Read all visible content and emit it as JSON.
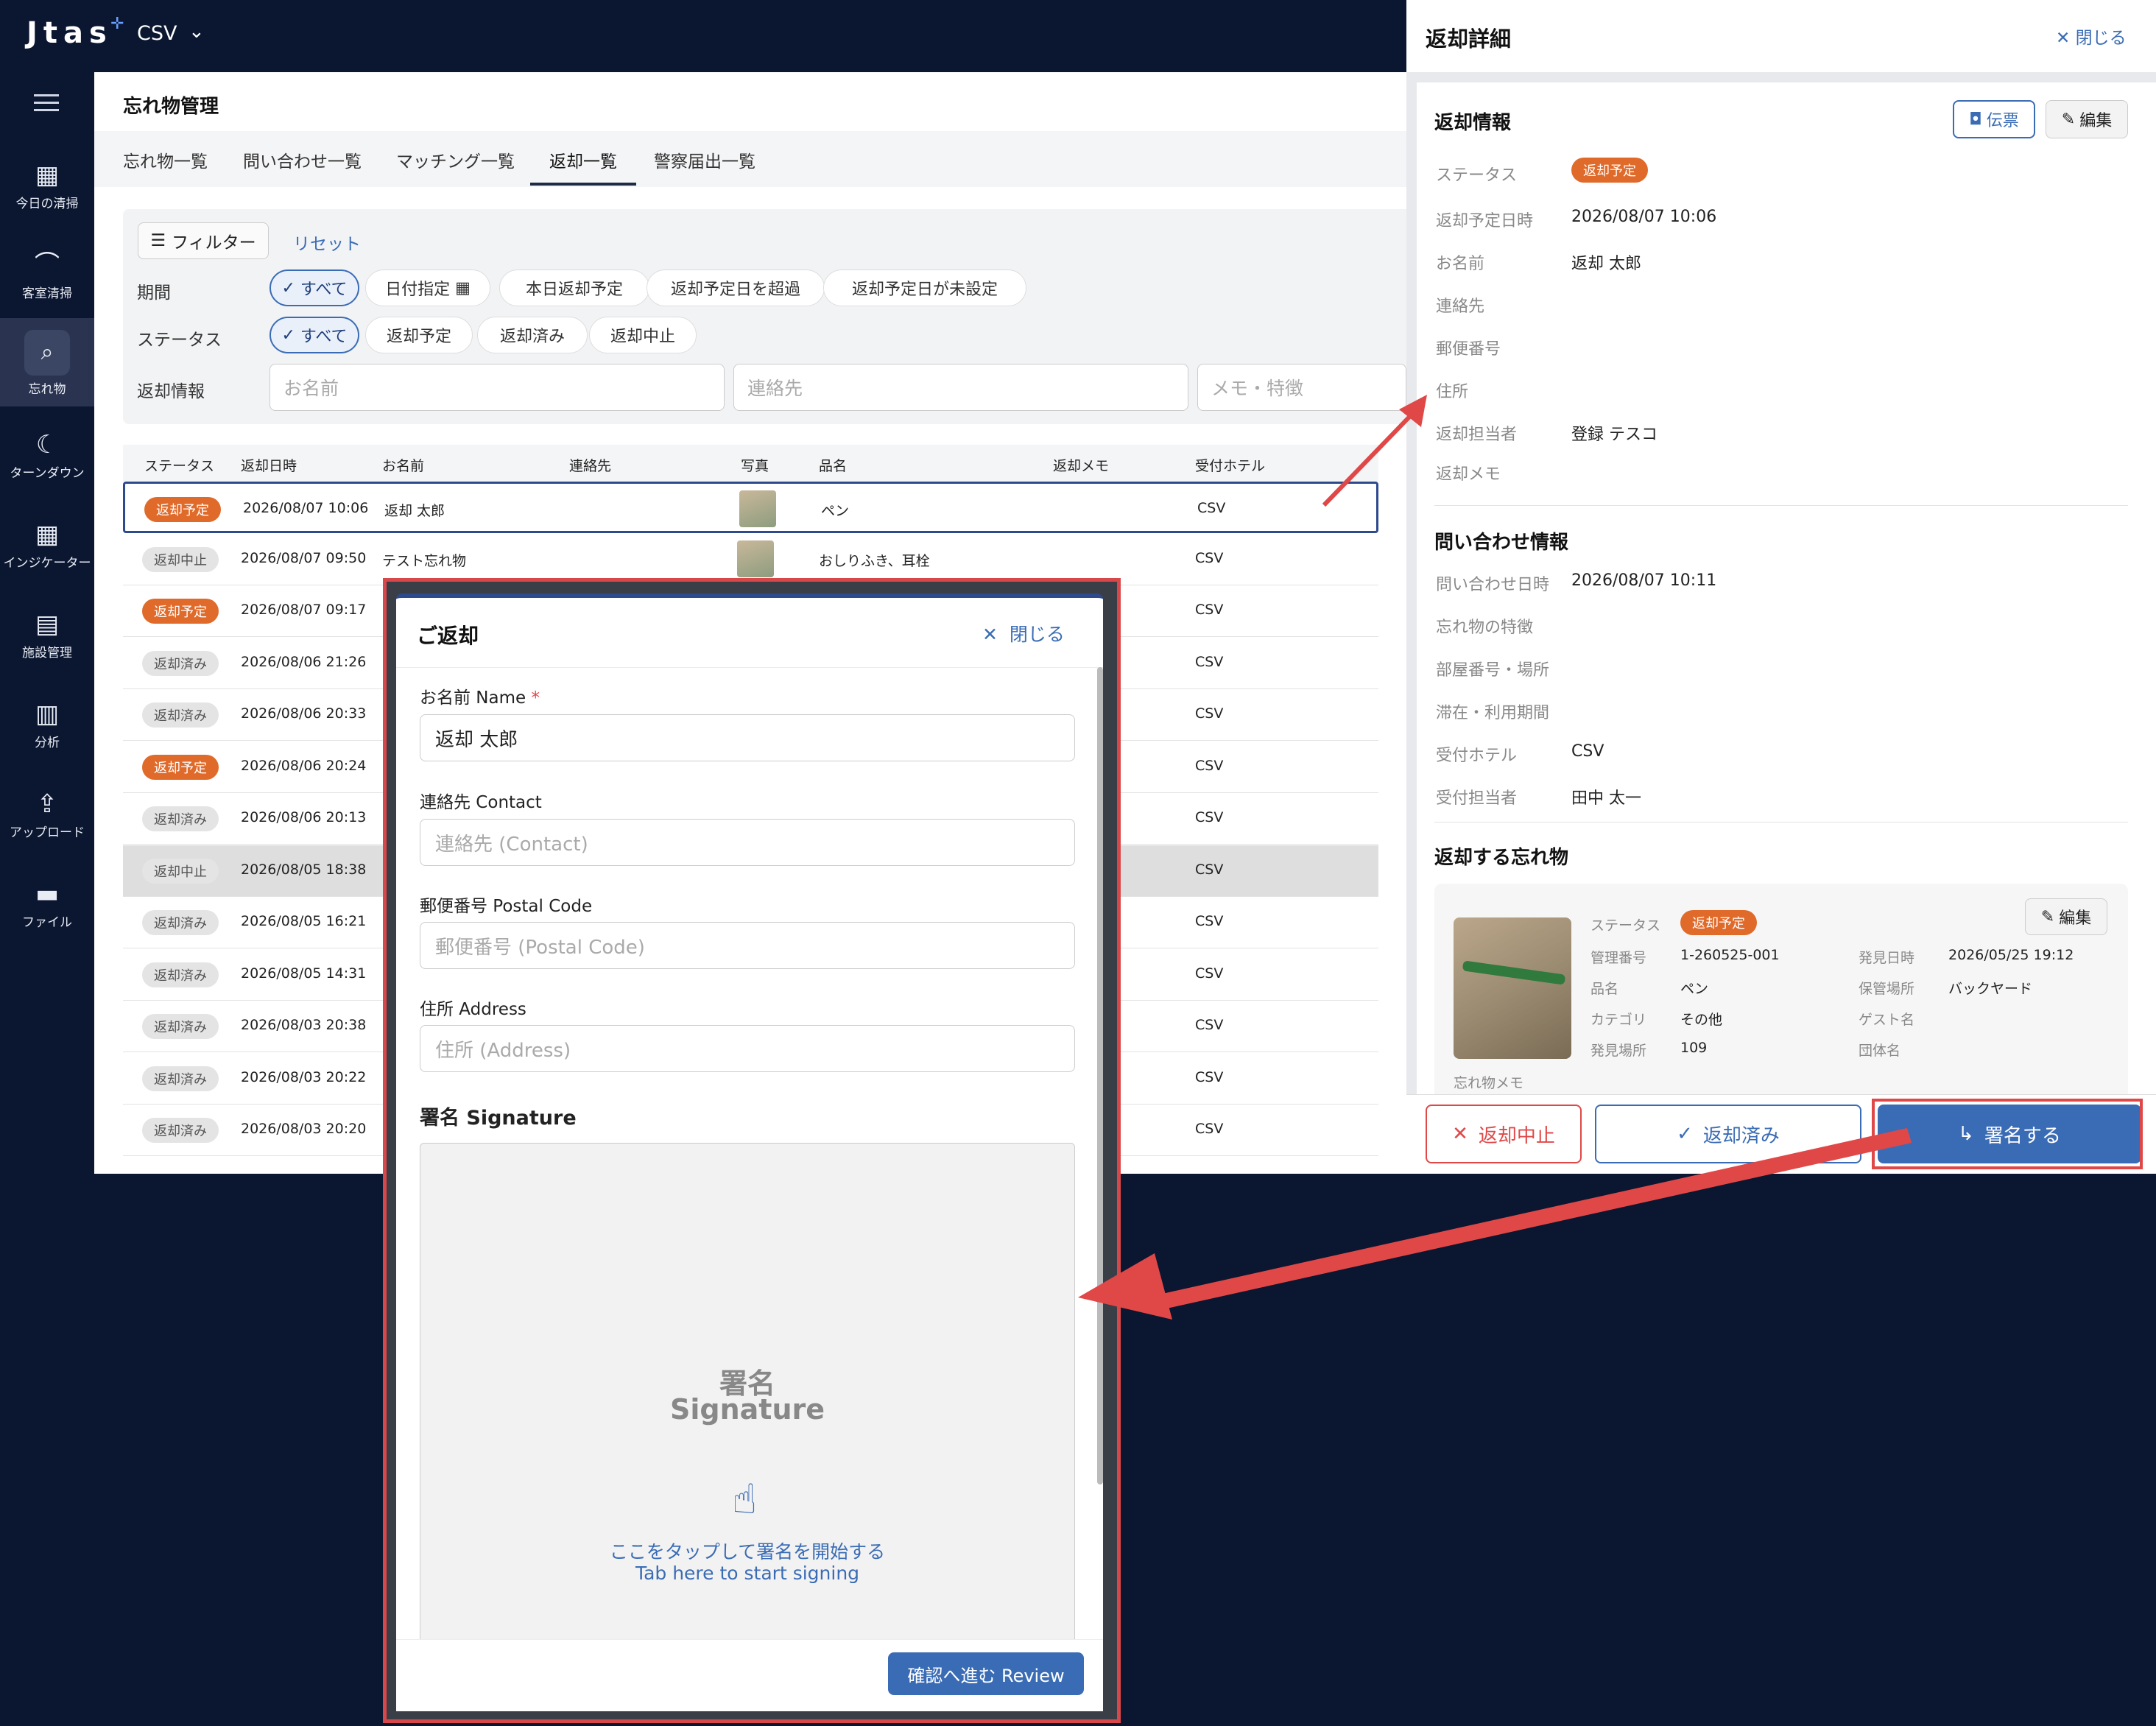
{
  "app": {
    "logo": "Jtas",
    "hotel": "CSV"
  },
  "sidebar": {
    "items": [
      {
        "label": "今日の清掃",
        "icon": "calendar-icon",
        "glyph": "▦"
      },
      {
        "label": "客室清掃",
        "icon": "broom-icon",
        "glyph": "⌒"
      },
      {
        "label": "忘れ物",
        "icon": "search-icon",
        "glyph": "⌕",
        "active": true
      },
      {
        "label": "ターンダウン",
        "icon": "moon-icon",
        "glyph": "☾"
      },
      {
        "label": "インジケーター",
        "icon": "grid-icon",
        "glyph": "▦"
      },
      {
        "label": "施設管理",
        "icon": "clipboard-icon",
        "glyph": "▤"
      },
      {
        "label": "分析",
        "icon": "chart-icon",
        "glyph": "▥"
      },
      {
        "label": "アップロード",
        "icon": "upload-icon",
        "glyph": "⇪"
      },
      {
        "label": "ファイル",
        "icon": "folder-icon",
        "glyph": "▬"
      }
    ]
  },
  "page": {
    "title": "忘れ物管理"
  },
  "tabs": [
    "忘れ物一覧",
    "問い合わせ一覧",
    "マッチング一覧",
    "返却一覧",
    "警察届出一覧"
  ],
  "filter": {
    "button": "フィルター",
    "reset": "リセット",
    "period_label": "期間",
    "period_chips": [
      "すべて",
      "日付指定",
      "本日返却予定",
      "返却予定日を超過",
      "返却予定日が未設定"
    ],
    "status_label": "ステータス",
    "status_chips": [
      "すべて",
      "返却予定",
      "返却済み",
      "返却中止"
    ],
    "info_label": "返却情報",
    "name_placeholder": "お名前",
    "contact_placeholder": "連絡先",
    "memo_placeholder": "メモ・特徴"
  },
  "table": {
    "headers": [
      "ステータス",
      "返却日時",
      "お名前",
      "連絡先",
      "写真",
      "品名",
      "返却メモ",
      "受付ホテル"
    ],
    "rows": [
      {
        "status": "返却予定",
        "datetime": "2026/08/07 10:06",
        "name": "返却 太郎",
        "item": "ペン",
        "hotel": "CSV",
        "photo": true
      },
      {
        "status": "返却中止",
        "datetime": "2026/08/07 09:50",
        "name": "テスト忘れ物",
        "item": "おしりふき、耳栓",
        "hotel": "CSV",
        "photo": true
      },
      {
        "status": "返却予定",
        "datetime": "2026/08/07 09:17",
        "name": "",
        "item": "",
        "hotel": "CSV"
      },
      {
        "status": "返却済み",
        "datetime": "2026/08/06 21:26",
        "name": "",
        "item": "",
        "hotel": "CSV"
      },
      {
        "status": "返却済み",
        "datetime": "2026/08/06 20:33",
        "name": "",
        "item": "",
        "hotel": "CSV"
      },
      {
        "status": "返却予定",
        "datetime": "2026/08/06 20:24",
        "name": "",
        "item": "",
        "hotel": "CSV"
      },
      {
        "status": "返却済み",
        "datetime": "2026/08/06 20:13",
        "name": "",
        "item": "",
        "hotel": "CSV"
      },
      {
        "status": "返却中止",
        "datetime": "2026/08/05 18:38",
        "name": "",
        "item": "",
        "hotel": "CSV"
      },
      {
        "status": "返却済み",
        "datetime": "2026/08/05 16:21",
        "name": "",
        "item": "",
        "hotel": "CSV"
      },
      {
        "status": "返却済み",
        "datetime": "2026/08/05 14:31",
        "name": "",
        "item": "",
        "hotel": "CSV"
      },
      {
        "status": "返却済み",
        "datetime": "2026/08/03 20:38",
        "name": "",
        "item": "",
        "hotel": "CSV"
      },
      {
        "status": "返却済み",
        "datetime": "2026/08/03 20:22",
        "name": "",
        "item": "",
        "hotel": "CSV"
      },
      {
        "status": "返却済み",
        "datetime": "2026/08/03 20:20",
        "name": "",
        "item": "",
        "hotel": "CSV"
      }
    ]
  },
  "detail": {
    "title": "返却詳細",
    "close": "閉じる",
    "return_info": {
      "title": "返却情報",
      "slip": "伝票",
      "edit": "編集",
      "fields": [
        {
          "label": "ステータス",
          "value": "返却予定",
          "badge": true
        },
        {
          "label": "返却予定日時",
          "value": "2026/08/07 10:06"
        },
        {
          "label": "お名前",
          "value": "返却 太郎"
        },
        {
          "label": "連絡先",
          "value": ""
        },
        {
          "label": "郵便番号",
          "value": ""
        },
        {
          "label": "住所",
          "value": ""
        },
        {
          "label": "返却担当者",
          "value": "登録 テスコ"
        },
        {
          "label": "返却メモ",
          "value": ""
        }
      ]
    },
    "inquiry_info": {
      "title": "問い合わせ情報",
      "fields": [
        {
          "label": "問い合わせ日時",
          "value": "2026/08/07 10:11"
        },
        {
          "label": "忘れ物の特徴",
          "value": ""
        },
        {
          "label": "部屋番号・場所",
          "value": ""
        },
        {
          "label": "滞在・利用期間",
          "value": ""
        },
        {
          "label": "受付ホテル",
          "value": "CSV"
        },
        {
          "label": "受付担当者",
          "value": "田中 太一"
        }
      ]
    },
    "items": {
      "title": "返却する忘れ物",
      "edit": "編集",
      "status_label": "ステータス",
      "status": "返却予定",
      "left": [
        {
          "label": "管理番号",
          "value": "1-260525-001"
        },
        {
          "label": "品名",
          "value": "ペン"
        },
        {
          "label": "カテゴリ",
          "value": "その他"
        },
        {
          "label": "発見場所",
          "value": "109"
        }
      ],
      "right": [
        {
          "label": "発見日時",
          "value": "2026/05/25 19:12"
        },
        {
          "label": "保管場所",
          "value": "バックヤード"
        },
        {
          "label": "ゲスト名",
          "value": ""
        },
        {
          "label": "団体名",
          "value": ""
        }
      ],
      "memo_label": "忘れ物メモ"
    },
    "footer": {
      "cancel": "返却中止",
      "done": "返却済み",
      "sign": "署名する"
    }
  },
  "modal": {
    "title": "ご返却",
    "close": "閉じる",
    "name_label": "お名前 Name",
    "name_required": "*",
    "name_value": "返却 太郎",
    "contact_label": "連絡先 Contact",
    "contact_placeholder": "連絡先 (Contact)",
    "postal_label": "郵便番号 Postal Code",
    "postal_placeholder": "郵便番号 (Postal Code)",
    "address_label": "住所 Address",
    "address_placeholder": "住所 (Address)",
    "signature_label": "署名 Signature",
    "signature_ja": "署名",
    "signature_en": "Signature",
    "tap_ja": "ここをタップして署名を開始する",
    "tap_en": "Tab here to start signing",
    "review": "確認へ進む Review"
  },
  "colors": {
    "navy": "#0b1630",
    "accent": "#3a6cb5",
    "orange": "#e06a2a",
    "red": "#e04848"
  }
}
